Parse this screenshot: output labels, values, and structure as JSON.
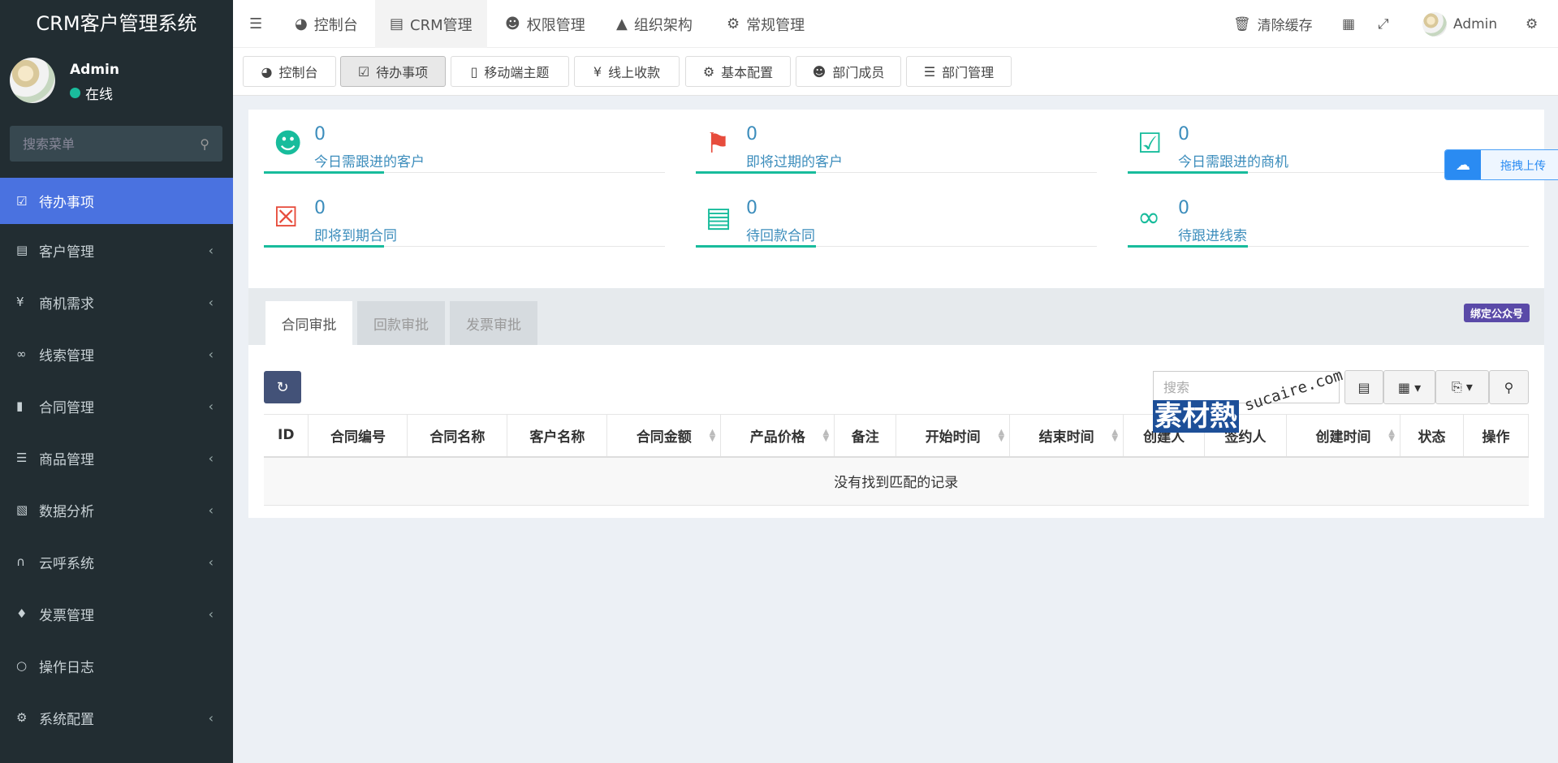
{
  "app": {
    "title": "CRM客户管理系统"
  },
  "user": {
    "name": "Admin",
    "status": "在线"
  },
  "sidebar": {
    "search_placeholder": "搜索菜单",
    "items": [
      {
        "label": "待办事项",
        "icon": "calendar-check-icon"
      },
      {
        "label": "客户管理",
        "icon": "id-card-icon"
      },
      {
        "label": "商机需求",
        "icon": "yen-icon"
      },
      {
        "label": "线索管理",
        "icon": "link-icon"
      },
      {
        "label": "合同管理",
        "icon": "bookmark-icon"
      },
      {
        "label": "商品管理",
        "icon": "list-icon"
      },
      {
        "label": "数据分析",
        "icon": "bar-chart-icon"
      },
      {
        "label": "云呼系统",
        "icon": "headphones-icon"
      },
      {
        "label": "发票管理",
        "icon": "ticket-icon"
      },
      {
        "label": "操作日志",
        "icon": "circle-icon"
      },
      {
        "label": "系统配置",
        "icon": "gears-icon"
      }
    ]
  },
  "topnav": {
    "items": [
      "控制台",
      "CRM管理",
      "权限管理",
      "组织架构",
      "常规管理"
    ],
    "clear_cache": "清除缓存",
    "user": "Admin"
  },
  "tabs": [
    "控制台",
    "待办事项",
    "移动端主题",
    "线上收款",
    "基本配置",
    "部门成员",
    "部门管理"
  ],
  "stats": [
    {
      "value": "0",
      "label": "今日需跟进的客户"
    },
    {
      "value": "0",
      "label": "即将过期的客户"
    },
    {
      "value": "0",
      "label": "今日需跟进的商机"
    },
    {
      "value": "0",
      "label": "即将到期合同"
    },
    {
      "value": "0",
      "label": "待回款合同"
    },
    {
      "value": "0",
      "label": "待跟进线索"
    }
  ],
  "approval_tabs": [
    "合同审批",
    "回款审批",
    "发票审批"
  ],
  "bind_badge": "绑定公众号",
  "table": {
    "search_placeholder": "搜索",
    "columns": [
      "ID",
      "合同编号",
      "合同名称",
      "客户名称",
      "合同金额",
      "产品价格",
      "备注",
      "开始时间",
      "结束时间",
      "创建人",
      "签约人",
      "创建时间",
      "状态",
      "操作"
    ],
    "empty_text": "没有找到匹配的记录"
  },
  "upload_widget": {
    "label": "拖拽上传"
  },
  "watermark": {
    "text": "素材熱",
    "url": "sucaire.com"
  }
}
